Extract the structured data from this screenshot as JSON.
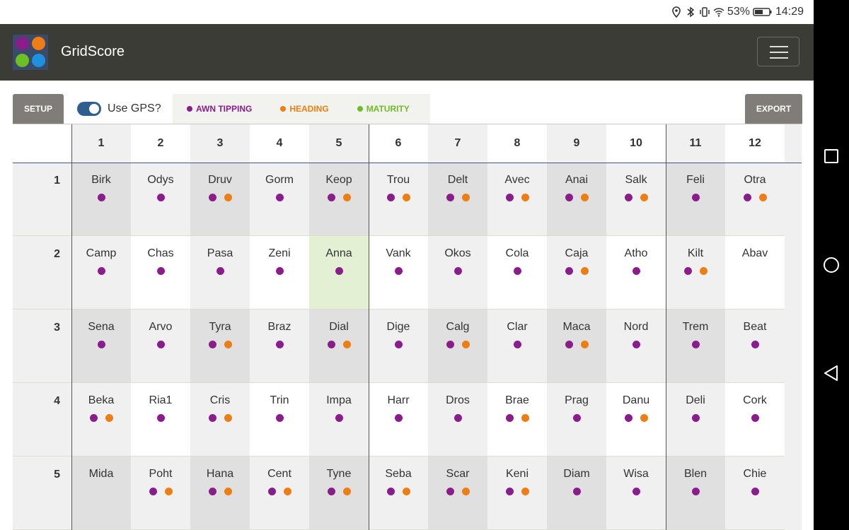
{
  "status": {
    "battery": "53%",
    "time": "14:29"
  },
  "app": {
    "title": "GridScore"
  },
  "toolbar": {
    "setup_label": "SETUP",
    "gps_label": "Use GPS?",
    "export_label": "EXPORT",
    "traits": [
      {
        "label": "AWN TIPPING",
        "color": "#8b1c8c"
      },
      {
        "label": "HEADING",
        "color": "#f07d10"
      },
      {
        "label": "MATURITY",
        "color": "#6cc025"
      }
    ]
  },
  "colors": {
    "awn": "#8b1c8c",
    "heading": "#f07d10",
    "maturity": "#6cc025",
    "highlight": "#e3f0d3"
  },
  "grid": {
    "columns": [
      "1",
      "2",
      "3",
      "4",
      "5",
      "6",
      "7",
      "8",
      "9",
      "10",
      "11",
      "12"
    ],
    "rows": [
      "1",
      "2",
      "3",
      "4",
      "5"
    ],
    "cells": [
      [
        {
          "name": "Birk",
          "dots": [
            "awn"
          ]
        },
        {
          "name": "Odys",
          "dots": [
            "awn"
          ]
        },
        {
          "name": "Druv",
          "dots": [
            "awn",
            "heading"
          ]
        },
        {
          "name": "Gorm",
          "dots": [
            "awn"
          ]
        },
        {
          "name": "Keop",
          "dots": [
            "awn",
            "heading"
          ]
        },
        {
          "name": "Trou",
          "dots": [
            "awn",
            "heading"
          ]
        },
        {
          "name": "Delt",
          "dots": [
            "awn",
            "heading"
          ]
        },
        {
          "name": "Avec",
          "dots": [
            "awn",
            "heading"
          ]
        },
        {
          "name": "Anai",
          "dots": [
            "awn",
            "heading"
          ]
        },
        {
          "name": "Salk",
          "dots": [
            "awn",
            "heading"
          ]
        },
        {
          "name": "Feli",
          "dots": [
            "awn"
          ]
        },
        {
          "name": "Otra",
          "dots": [
            "awn",
            "heading"
          ]
        }
      ],
      [
        {
          "name": "Camp",
          "dots": [
            "awn"
          ]
        },
        {
          "name": "Chas",
          "dots": [
            "awn"
          ]
        },
        {
          "name": "Pasa",
          "dots": [
            "awn"
          ]
        },
        {
          "name": "Zeni",
          "dots": [
            "awn"
          ]
        },
        {
          "name": "Anna",
          "dots": [
            "awn"
          ],
          "highlight": true
        },
        {
          "name": "Vank",
          "dots": [
            "awn"
          ]
        },
        {
          "name": "Okos",
          "dots": [
            "awn"
          ]
        },
        {
          "name": "Cola",
          "dots": [
            "awn"
          ]
        },
        {
          "name": "Caja",
          "dots": [
            "awn",
            "heading"
          ]
        },
        {
          "name": "Atho",
          "dots": [
            "awn"
          ]
        },
        {
          "name": "Kilt",
          "dots": [
            "awn",
            "heading"
          ]
        },
        {
          "name": "Abav",
          "dots": []
        }
      ],
      [
        {
          "name": "Sena",
          "dots": [
            "awn"
          ]
        },
        {
          "name": "Arvo",
          "dots": [
            "awn"
          ]
        },
        {
          "name": "Tyra",
          "dots": [
            "awn",
            "heading"
          ]
        },
        {
          "name": "Braz",
          "dots": [
            "awn"
          ]
        },
        {
          "name": "Dial",
          "dots": [
            "awn",
            "heading"
          ]
        },
        {
          "name": "Dige",
          "dots": [
            "awn"
          ]
        },
        {
          "name": "Calg",
          "dots": [
            "awn",
            "heading"
          ]
        },
        {
          "name": "Clar",
          "dots": [
            "awn"
          ]
        },
        {
          "name": "Maca",
          "dots": [
            "awn",
            "heading"
          ]
        },
        {
          "name": "Nord",
          "dots": [
            "awn"
          ]
        },
        {
          "name": "Trem",
          "dots": [
            "awn"
          ]
        },
        {
          "name": "Beat",
          "dots": [
            "awn"
          ]
        }
      ],
      [
        {
          "name": "Beka",
          "dots": [
            "awn",
            "heading"
          ]
        },
        {
          "name": "Ria1",
          "dots": [
            "awn"
          ]
        },
        {
          "name": "Cris",
          "dots": [
            "awn",
            "heading"
          ]
        },
        {
          "name": "Trin",
          "dots": [
            "awn"
          ]
        },
        {
          "name": "Impa",
          "dots": [
            "awn"
          ]
        },
        {
          "name": "Harr",
          "dots": [
            "awn"
          ]
        },
        {
          "name": "Dros",
          "dots": [
            "awn"
          ]
        },
        {
          "name": "Brae",
          "dots": [
            "awn",
            "heading"
          ]
        },
        {
          "name": "Prag",
          "dots": [
            "awn"
          ]
        },
        {
          "name": "Danu",
          "dots": [
            "awn",
            "heading"
          ]
        },
        {
          "name": "Deli",
          "dots": [
            "awn"
          ]
        },
        {
          "name": "Cork",
          "dots": [
            "awn"
          ]
        }
      ],
      [
        {
          "name": "Mida",
          "dots": []
        },
        {
          "name": "Poht",
          "dots": [
            "awn",
            "heading"
          ]
        },
        {
          "name": "Hana",
          "dots": [
            "awn",
            "heading"
          ]
        },
        {
          "name": "Cent",
          "dots": [
            "awn",
            "heading"
          ]
        },
        {
          "name": "Tyne",
          "dots": [
            "awn",
            "heading"
          ]
        },
        {
          "name": "Seba",
          "dots": [
            "awn",
            "heading"
          ]
        },
        {
          "name": "Scar",
          "dots": [
            "awn",
            "heading"
          ]
        },
        {
          "name": "Keni",
          "dots": [
            "awn",
            "heading"
          ]
        },
        {
          "name": "Diam",
          "dots": [
            "awn"
          ]
        },
        {
          "name": "Wisa",
          "dots": [
            "awn"
          ]
        },
        {
          "name": "Blen",
          "dots": [
            "awn"
          ]
        },
        {
          "name": "Chie",
          "dots": [
            "awn"
          ]
        }
      ]
    ]
  }
}
